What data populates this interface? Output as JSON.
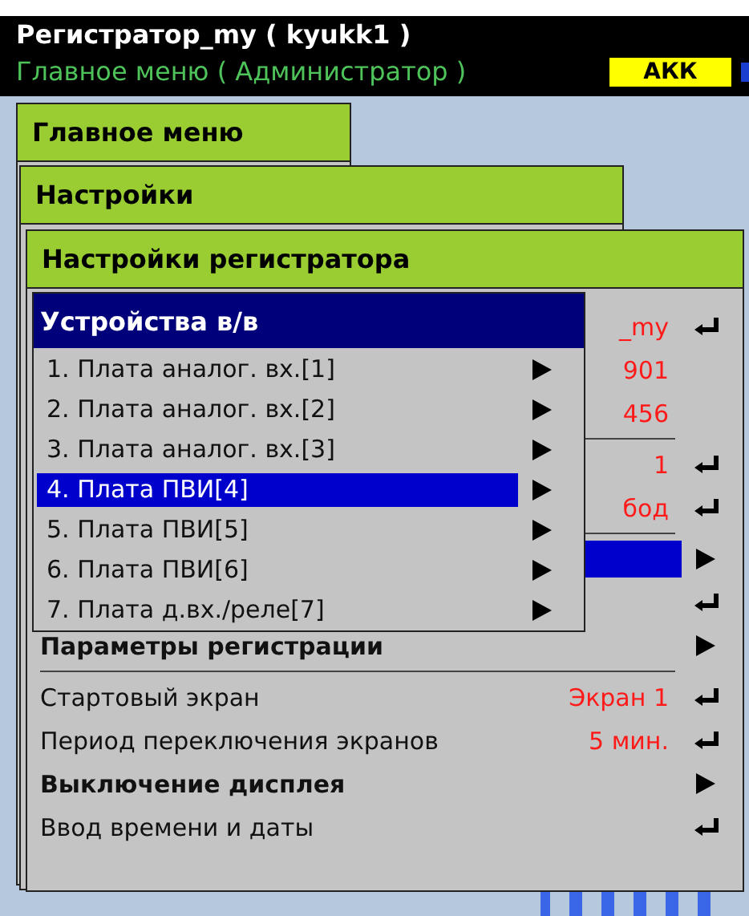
{
  "header": {
    "title": "Регистратор_my ( kyukk1 )",
    "subtitle": "Главное меню ( Администратор )",
    "badge": "АКК"
  },
  "windows": [
    {
      "title": "Главное меню"
    },
    {
      "title": "Настройки"
    },
    {
      "title": "Настройки регистратора"
    }
  ],
  "settings": {
    "rows": [
      {
        "kind": "enter",
        "value": "_my",
        "selected": false
      },
      {
        "kind": "plain",
        "value": "901",
        "selected": false
      },
      {
        "kind": "plain",
        "value": "456",
        "selected": false
      },
      {
        "kind": "divider"
      },
      {
        "kind": "enter",
        "value": "1",
        "selected": false
      },
      {
        "kind": "enter",
        "value": "бод",
        "selected": false
      },
      {
        "kind": "divider"
      },
      {
        "kind": "submenu",
        "selected": true
      },
      {
        "kind": "enter",
        "selected": false
      },
      {
        "kind": "submenu",
        "label": "Параметры регистрации",
        "bold": true,
        "selected": false
      },
      {
        "kind": "divider"
      },
      {
        "kind": "enter",
        "label": "Стартовый экран",
        "value": "Экран 1",
        "bold": false,
        "selected": false
      },
      {
        "kind": "enter",
        "label": "Период переключения экранов",
        "value": "5 мин.",
        "bold": false,
        "selected": false
      },
      {
        "kind": "submenu",
        "label": "Выключение дисплея",
        "bold": true,
        "selected": false
      },
      {
        "kind": "enter",
        "label": "Ввод времени и даты",
        "bold": false,
        "selected": false
      }
    ]
  },
  "popup": {
    "title": "Устройства в/в",
    "items": [
      {
        "label": "1. Плата аналог. вх.[1]",
        "selected": false
      },
      {
        "label": "2. Плата аналог. вх.[2]",
        "selected": false
      },
      {
        "label": "3. Плата аналог. вх.[3]",
        "selected": false
      },
      {
        "label": "4. Плата ПВИ[4]",
        "selected": true
      },
      {
        "label": "5. Плата ПВИ[5]",
        "selected": false
      },
      {
        "label": "6. Плата ПВИ[6]",
        "selected": false
      },
      {
        "label": "7. Плата д.вх./реле[7]",
        "selected": false
      }
    ]
  }
}
